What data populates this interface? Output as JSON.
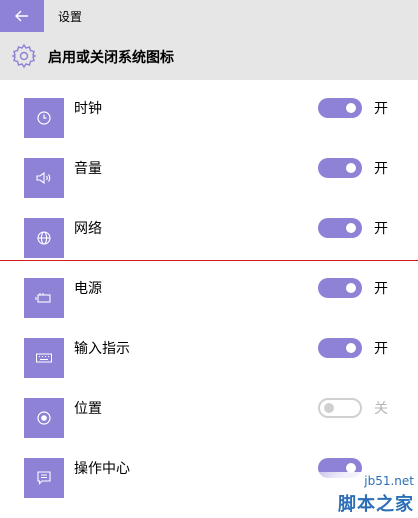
{
  "titlebar": {
    "title": "设置",
    "back_icon": "arrow-left-icon"
  },
  "header": {
    "heading": "启用或关闭系统图标",
    "icon": "gear-icon"
  },
  "accent_color": "#8d82d6",
  "items": [
    {
      "label": "时钟",
      "icon": "clock-icon",
      "state": "开",
      "on": true
    },
    {
      "label": "音量",
      "icon": "speaker-icon",
      "state": "开",
      "on": true
    },
    {
      "label": "网络",
      "icon": "globe-icon",
      "state": "开",
      "on": true
    },
    {
      "label": "电源",
      "icon": "battery-icon",
      "state": "开",
      "on": true
    },
    {
      "label": "输入指示",
      "icon": "keyboard-icon",
      "state": "开",
      "on": true
    },
    {
      "label": "位置",
      "icon": "location-icon",
      "state": "关",
      "on": false
    },
    {
      "label": "操作中心",
      "icon": "action-center-icon",
      "state": "",
      "on": true
    }
  ],
  "watermark": {
    "url": "jb51.net",
    "brand": "脚本之家"
  }
}
